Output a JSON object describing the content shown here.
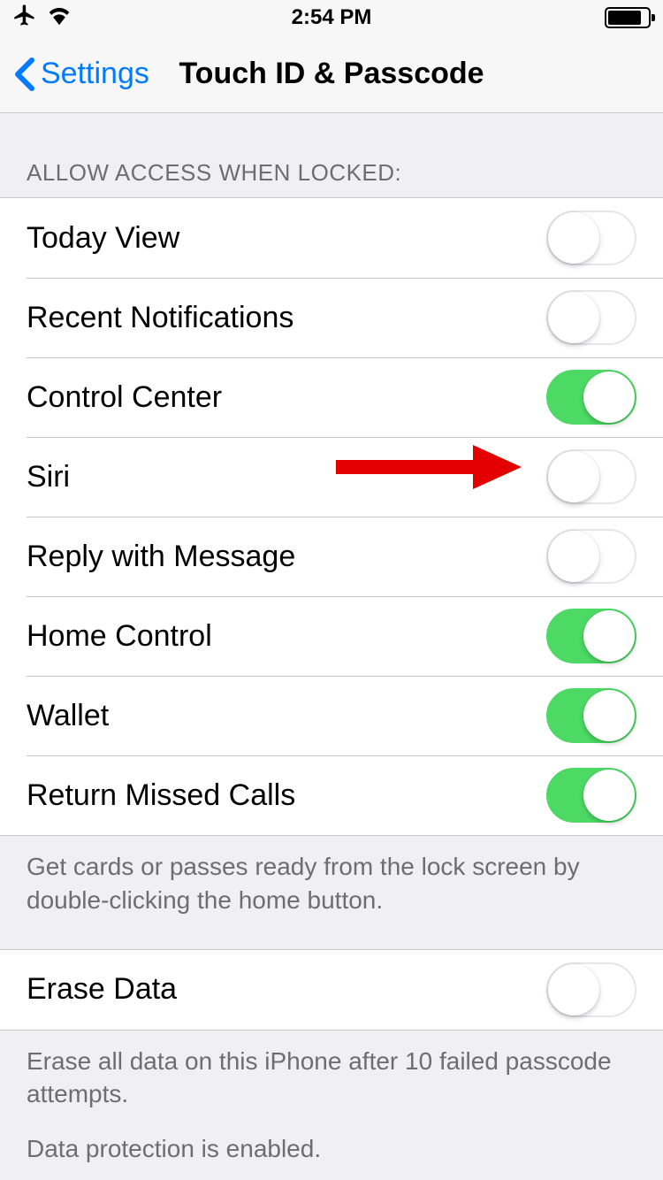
{
  "statusBar": {
    "time": "2:54 PM"
  },
  "nav": {
    "back": "Settings",
    "title": "Touch ID & Passcode"
  },
  "sections": {
    "allowAccess": {
      "header": "ALLOW ACCESS WHEN LOCKED:",
      "footer": "Get cards or passes ready from the lock screen by double-clicking the home button.",
      "items": [
        {
          "label": "Today View",
          "on": false
        },
        {
          "label": "Recent Notifications",
          "on": false
        },
        {
          "label": "Control Center",
          "on": true
        },
        {
          "label": "Siri",
          "on": false
        },
        {
          "label": "Reply with Message",
          "on": false
        },
        {
          "label": "Home Control",
          "on": true
        },
        {
          "label": "Wallet",
          "on": true
        },
        {
          "label": "Return Missed Calls",
          "on": true
        }
      ]
    },
    "erase": {
      "items": [
        {
          "label": "Erase Data",
          "on": false
        }
      ],
      "footer1": "Erase all data on this iPhone after 10 failed passcode attempts.",
      "footer2": "Data protection is enabled."
    }
  }
}
